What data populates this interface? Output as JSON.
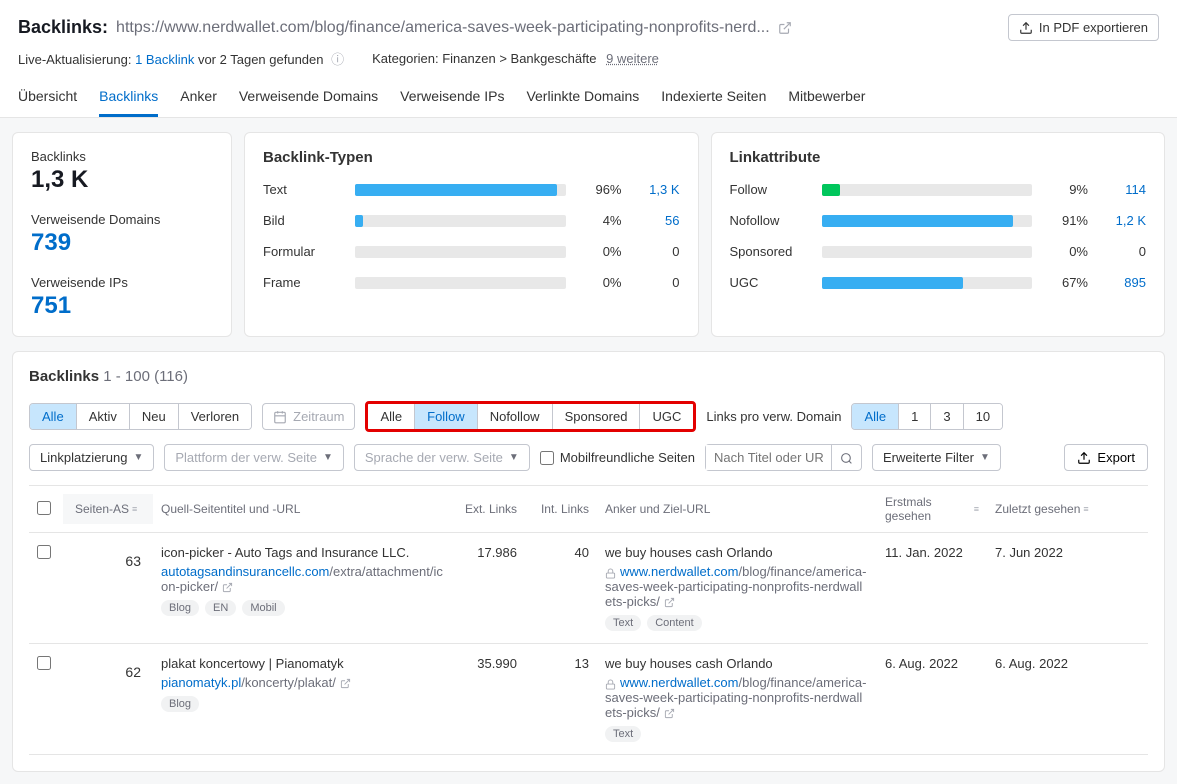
{
  "header": {
    "label": "Backlinks:",
    "url": "https://www.nerdwallet.com/blog/finance/america-saves-week-participating-nonprofits-nerd...",
    "exportPdf": "In PDF exportieren"
  },
  "meta": {
    "liveUpdate": "Live-Aktualisierung:",
    "backlinksFound": "1 Backlink",
    "foundAgo": "vor 2 Tagen gefunden",
    "categories": "Kategorien: Finanzen > Bankgeschäfte",
    "moreCats": "9 weitere"
  },
  "tabs": [
    "Übersicht",
    "Backlinks",
    "Anker",
    "Verweisende Domains",
    "Verweisende IPs",
    "Verlinkte Domains",
    "Indexierte Seiten",
    "Mitbewerber"
  ],
  "stats": {
    "backlinks": {
      "label": "Backlinks",
      "value": "1,3 K"
    },
    "refDomains": {
      "label": "Verweisende Domains",
      "value": "739"
    },
    "refIps": {
      "label": "Verweisende IPs",
      "value": "751"
    }
  },
  "types": {
    "title": "Backlink-Typen",
    "rows": [
      {
        "label": "Text",
        "pct": "96%",
        "width": 96,
        "count": "1,3 K"
      },
      {
        "label": "Bild",
        "pct": "4%",
        "width": 4,
        "count": "56"
      },
      {
        "label": "Formular",
        "pct": "0%",
        "width": 0,
        "count": "0"
      },
      {
        "label": "Frame",
        "pct": "0%",
        "width": 0,
        "count": "0"
      }
    ]
  },
  "attrs": {
    "title": "Linkattribute",
    "rows": [
      {
        "label": "Follow",
        "pct": "9%",
        "width": 9,
        "count": "114",
        "green": true
      },
      {
        "label": "Nofollow",
        "pct": "91%",
        "width": 91,
        "count": "1,2 K"
      },
      {
        "label": "Sponsored",
        "pct": "0%",
        "width": 0,
        "count": "0"
      },
      {
        "label": "UGC",
        "pct": "67%",
        "width": 67,
        "count": "895"
      }
    ]
  },
  "panel": {
    "title": "Backlinks",
    "range": "1 - 100 (116)",
    "segStatus": [
      "Alle",
      "Aktiv",
      "Neu",
      "Verloren"
    ],
    "dateRange": "Zeitraum",
    "segFollow": [
      "Alle",
      "Follow",
      "Nofollow",
      "Sponsored",
      "UGC"
    ],
    "perDomainLabel": "Links pro verw. Domain",
    "segPerDomain": [
      "Alle",
      "1",
      "3",
      "10"
    ],
    "ddPlacement": "Linkplatzierung",
    "ddPlatform": "Plattform der verw. Seite",
    "ddLang": "Sprache der verw. Seite",
    "chkMobile": "Mobilfreundliche Seiten",
    "searchPlaceholder": "Nach Titel oder UR...",
    "ddAdvanced": "Erweiterte Filter",
    "exportBtn": "Export"
  },
  "table": {
    "headers": {
      "as": "Seiten-AS",
      "title": "Quell-Seitentitel und -URL",
      "ext": "Ext. Links",
      "int": "Int. Links",
      "anchor": "Anker und Ziel-URL",
      "first": "Erstmals gesehen",
      "last": "Zuletzt gesehen"
    },
    "rows": [
      {
        "as": "63",
        "title": "icon-picker - Auto Tags and Insurance LLC.",
        "urlDomain": "autotagsandinsurancellc.com",
        "urlPath": "/extra/attachment/icon-picker/",
        "tags": [
          "Blog",
          "EN",
          "Mobil"
        ],
        "ext": "17.986",
        "int": "40",
        "anchor": "we buy houses cash Orlando",
        "targetDomain": "www.nerdwallet.com",
        "targetPath": "/blog/finance/america-saves-week-participating-nonprofits-nerdwallets-picks/",
        "anchorTags": [
          "Text",
          "Content"
        ],
        "first": "11. Jan. 2022",
        "last": "7. Jun 2022"
      },
      {
        "as": "62",
        "title": "plakat koncertowy | Pianomatyk",
        "urlDomain": "pianomatyk.pl",
        "urlPath": "/koncerty/plakat/",
        "tags": [
          "Blog"
        ],
        "ext": "35.990",
        "int": "13",
        "anchor": "we buy houses cash Orlando",
        "targetDomain": "www.nerdwallet.com",
        "targetPath": "/blog/finance/america-saves-week-participating-nonprofits-nerdwallets-picks/",
        "anchorTags": [
          "Text"
        ],
        "first": "6. Aug. 2022",
        "last": "6. Aug. 2022"
      }
    ]
  }
}
